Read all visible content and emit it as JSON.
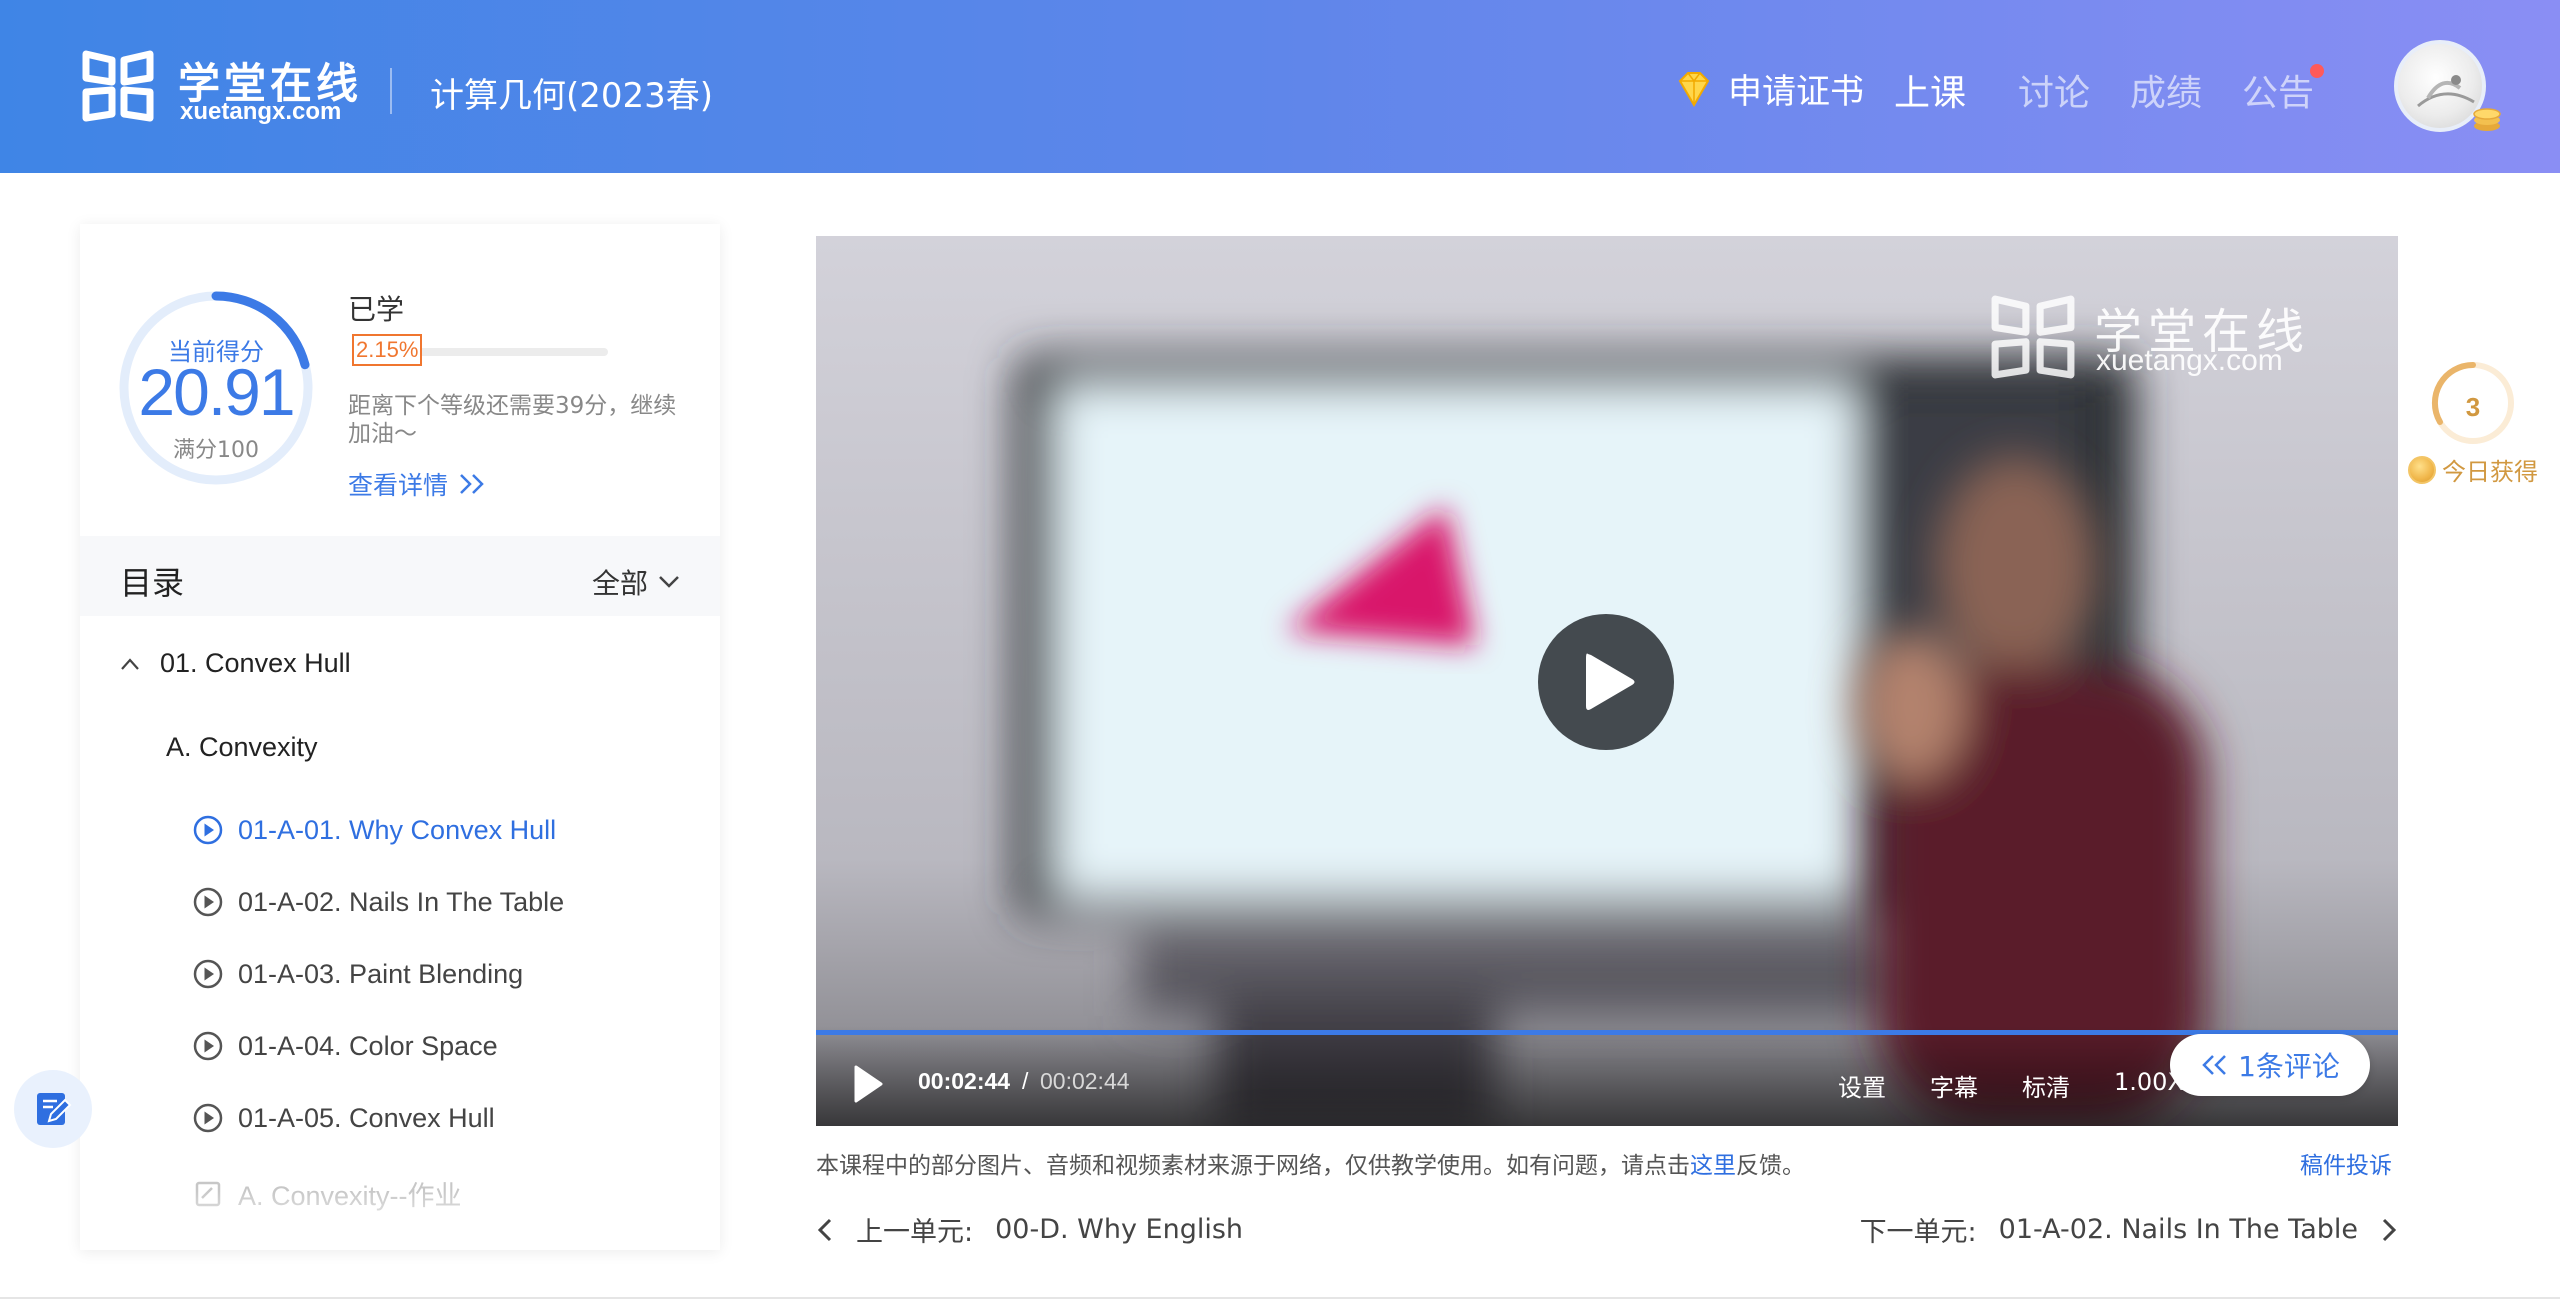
{
  "header": {
    "logo_cn": "学堂在线",
    "logo_en": "xuetangx.com",
    "course_title": "计算几何(2023春)",
    "cert_label": "申请证书",
    "nav": [
      {
        "label": "上课",
        "active": true
      },
      {
        "label": "讨论",
        "active": false
      },
      {
        "label": "成绩",
        "active": false
      },
      {
        "label": "公告",
        "active": false,
        "has_dot": true
      }
    ]
  },
  "score": {
    "label": "当前得分",
    "value": "20.91",
    "max_label": "满分100",
    "fraction": 0.2091
  },
  "progress": {
    "label": "已学",
    "percent_text": "2.15%",
    "fraction": 0.0215,
    "next_level_text": "距离下个等级还需要39分，继续加油～",
    "detail_link": "查看详情"
  },
  "toc": {
    "title": "目录",
    "filter": "全部",
    "chapter": "01. Convex Hull",
    "section": "A. Convexity",
    "lessons": [
      {
        "label": "01-A-01. Why Convex Hull",
        "state": "active"
      },
      {
        "label": "01-A-02. Nails In The Table",
        "state": "normal"
      },
      {
        "label": "01-A-03. Paint Blending",
        "state": "normal"
      },
      {
        "label": "01-A-04. Color Space",
        "state": "normal"
      },
      {
        "label": "01-A-05. Convex Hull",
        "state": "normal"
      },
      {
        "label": "A. Convexity--作业",
        "state": "faded"
      }
    ]
  },
  "video": {
    "watermark_cn": "学堂在线",
    "watermark_en": "xuetangx.com",
    "time_current": "00:02:44",
    "time_separator": "/",
    "time_total": "00:02:44",
    "settings": "设置",
    "subtitles": "字幕",
    "quality": "标清",
    "speed": "1.00X",
    "comment_pill": "1条评论",
    "played_fraction": 1.0
  },
  "below_video": {
    "disclaimer_prefix": "本课程中的部分图片、音频和视频素材来源于网络，仅供教学使用。如有问题，请点击",
    "disclaimer_link": "这里",
    "disclaimer_suffix": "反馈。",
    "report": "稿件投诉",
    "prev_label": "上一单元:",
    "prev_title": "00-D. Why English",
    "next_label": "下一单元:",
    "next_title": "01-A-02. Nails In The Table"
  },
  "today": {
    "count": "3",
    "label": "今日获得"
  },
  "colors": {
    "accent": "#3c7ae6",
    "progress": "#f0762f",
    "gold": "#d19840",
    "header_start": "#3f85e6",
    "header_end": "#8a8ef4"
  }
}
